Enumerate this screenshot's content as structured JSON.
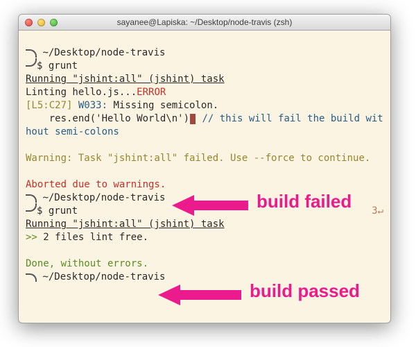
{
  "window": {
    "title": "sayanee@Lapiska: ~/Desktop/node-travis (zsh)"
  },
  "run1": {
    "cwd": "~/Desktop/node-travis",
    "prompt": "$",
    "cmd": "grunt",
    "task_line": "Running \"jshint:all\" (jshint) task",
    "lint_line_pre": "Linting hello.js...",
    "lint_error": "ERROR",
    "loc": "[L5:C27]",
    "code": "W033:",
    "msg": "Missing semicolon.",
    "src": "    res.end('Hello World\\n')",
    "comment": " // this will fail the build without semi-colons",
    "warning": "Warning: ",
    "warning_rest": "Task \"jshint:all\" failed. Use --force to continue.",
    "aborted": "Aborted due to warnings."
  },
  "run2": {
    "cwd": "~/Desktop/node-travis",
    "prompt": "$",
    "cmd": "grunt",
    "exit": "3",
    "return": "↵",
    "task_line": "Running \"jshint:all\" (jshint) task",
    "ok_mark": ">> ",
    "ok_rest": "2 files lint free.",
    "done": "Done, without errors."
  },
  "tail": {
    "cwd": "~/Desktop/node-travis"
  },
  "annotations": {
    "failed": "build failed",
    "passed": "build passed"
  }
}
